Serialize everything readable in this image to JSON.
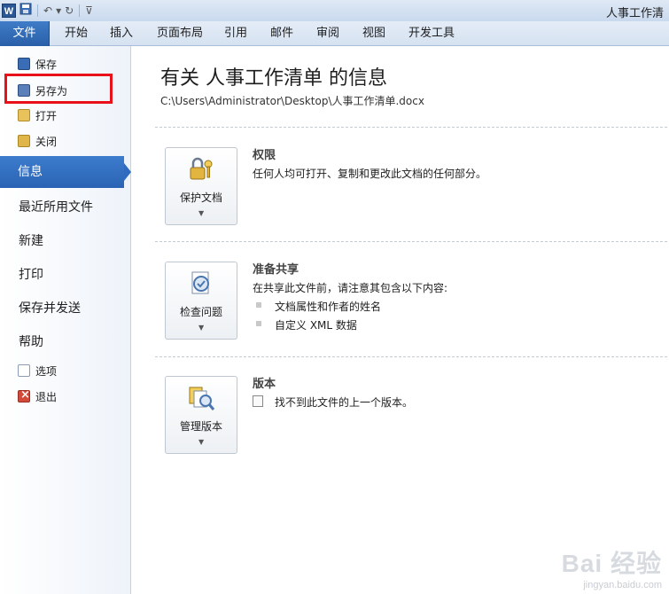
{
  "window": {
    "title": "人事工作清",
    "app_icon_letter": "W",
    "qat": {
      "undo": "↶",
      "dropdown": "▾",
      "redo": "↻",
      "customize": "⊽"
    }
  },
  "ribbon": {
    "tabs": [
      "文件",
      "开始",
      "插入",
      "页面布局",
      "引用",
      "邮件",
      "审阅",
      "视图",
      "开发工具"
    ]
  },
  "sidebar": {
    "small_items": [
      {
        "label": "保存",
        "icon": "save-icon"
      },
      {
        "label": "另存为",
        "icon": "save-as-icon"
      },
      {
        "label": "打开",
        "icon": "open-folder-icon"
      },
      {
        "label": "关闭",
        "icon": "close-folder-icon"
      }
    ],
    "selected": "信息",
    "large_items": [
      "最近所用文件",
      "新建",
      "打印",
      "保存并发送",
      "帮助"
    ],
    "bottom_items": [
      {
        "label": "选项",
        "icon": "options-icon"
      },
      {
        "label": "退出",
        "icon": "exit-icon"
      }
    ]
  },
  "main": {
    "title": "有关 人事工作清单 的信息",
    "path": "C:\\Users\\Administrator\\Desktop\\人事工作清单.docx",
    "sections": {
      "permissions": {
        "button": "保护文档",
        "title": "权限",
        "text": "任何人均可打开、复制和更改此文档的任何部分。"
      },
      "prepare": {
        "button": "检查问题",
        "title": "准备共享",
        "text": "在共享此文件前，请注意其包含以下内容:",
        "bullets": [
          "文档属性和作者的姓名",
          "自定义 XML 数据"
        ]
      },
      "versions": {
        "button": "管理版本",
        "title": "版本",
        "text": "找不到此文件的上一个版本。"
      }
    }
  },
  "watermark": {
    "brand": "Bai 经验",
    "url": "jingyan.baidu.com"
  },
  "colors": {
    "accent": "#2a63b4",
    "highlight": "#e8111a"
  }
}
